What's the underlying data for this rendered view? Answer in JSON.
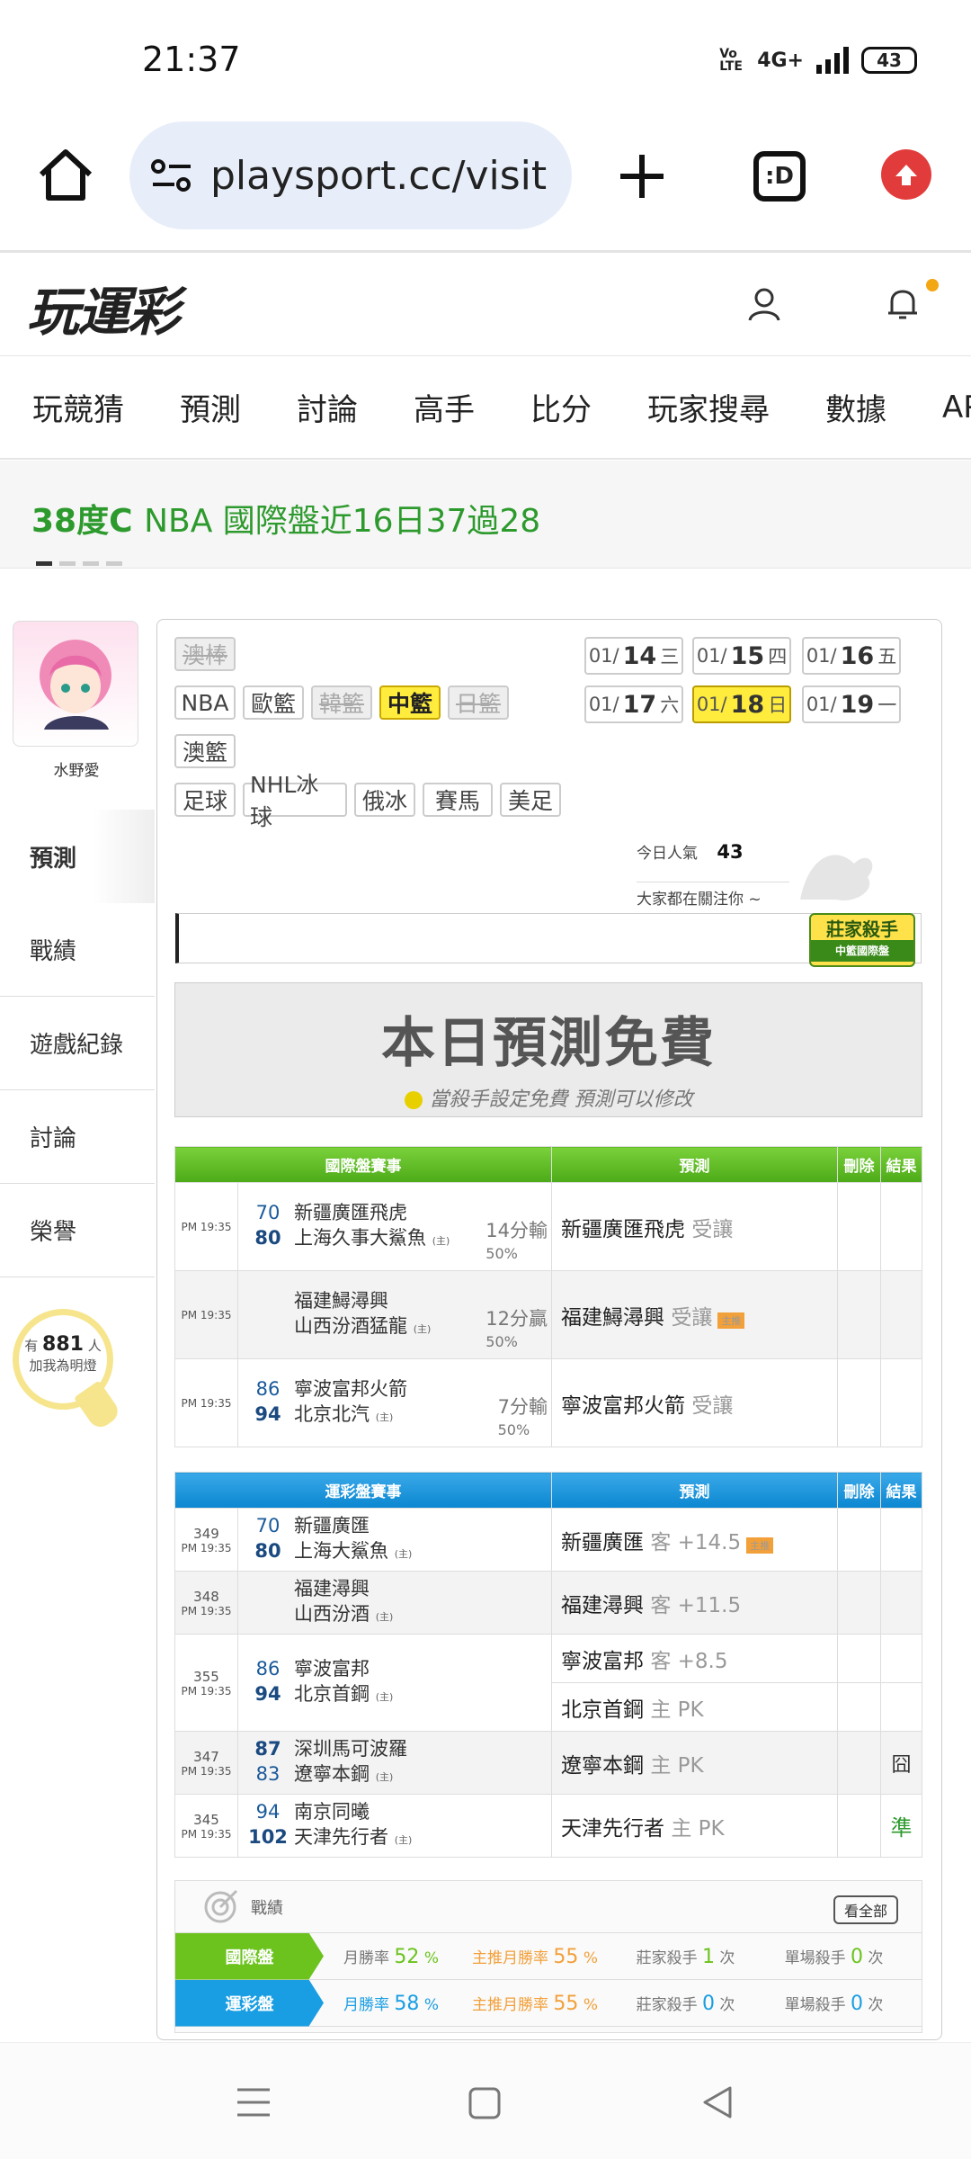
{
  "status": {
    "time": "21:37",
    "volte": "Vo LTE",
    "network": "4G+",
    "battery": "43"
  },
  "browser": {
    "url": "playsport.cc/visit",
    "tab_label": ":D"
  },
  "site": {
    "logo": "玩運彩"
  },
  "nav": [
    "玩競猜",
    "預測",
    "討論",
    "高手",
    "比分",
    "玩家搜尋",
    "數據",
    "APP"
  ],
  "marquee": {
    "highlight": "38度C",
    "text": "NBA 國際盤近16日37過28"
  },
  "profile": {
    "name": "水野愛",
    "fans_prefix": "有",
    "fans_count": "881",
    "fans_suffix": "人",
    "fans_label": "加我為明燈"
  },
  "side_menu": [
    "預測",
    "戰績",
    "遊戲紀錄",
    "討論",
    "榮譽"
  ],
  "sports": {
    "row1": [
      "澳棒"
    ],
    "row2": [
      "NBA",
      "歐籃",
      "韓籃",
      "中籃",
      "日籃"
    ],
    "row3": [
      "澳籃"
    ],
    "row4": [
      "足球",
      "NHL冰球",
      "俄冰",
      "賽馬",
      "美足"
    ]
  },
  "dates": [
    {
      "md": "01/",
      "d": "14",
      "w": "三"
    },
    {
      "md": "01/",
      "d": "15",
      "w": "四"
    },
    {
      "md": "01/",
      "d": "16",
      "w": "五"
    },
    {
      "md": "01/",
      "d": "17",
      "w": "六"
    },
    {
      "md": "01/",
      "d": "18",
      "w": "日"
    },
    {
      "md": "01/",
      "d": "19",
      "w": "一"
    }
  ],
  "popularity": {
    "label": "今日人氣",
    "value": "43",
    "watching": "大家都在關注你 ~"
  },
  "ribbon": {
    "title": "莊家殺手",
    "sub": "中籃國際盤"
  },
  "banner": {
    "title": "本日預測免費",
    "subtitle": "當殺手設定免費  預測可以修改"
  },
  "intl": {
    "headers": [
      "國際盤賽事",
      "預測",
      "刪除",
      "結果"
    ],
    "rows": [
      {
        "time": "PM 19:35",
        "s1": "70",
        "s2": "80",
        "t1": "新疆廣匯飛虎",
        "t2": "上海久事大鯊魚",
        "home": "(主)",
        "res1": "14分輸",
        "res2": "50%",
        "pred": "新疆廣匯飛虎",
        "note": "受讓",
        "mark": ""
      },
      {
        "time": "PM 19:35",
        "s1": "",
        "s2": "",
        "t1": "福建鱘潯興",
        "t2": "山西汾酒猛龍",
        "home": "(主)",
        "res1": "12分贏",
        "res2": "50%",
        "pred": "福建鱘潯興",
        "note": "受讓",
        "mark": "主推"
      },
      {
        "time": "PM 19:35",
        "s1": "86",
        "s2": "94",
        "t1": "寧波富邦火箭",
        "t2": "北京北汽",
        "home": "(主)",
        "res1": "7分輸",
        "res2": "50%",
        "pred": "寧波富邦火箭",
        "note": "受讓",
        "mark": ""
      }
    ]
  },
  "local": {
    "headers": [
      "運彩盤賽事",
      "預測",
      "刪除",
      "結果"
    ],
    "rows": [
      {
        "no": "349",
        "time": "PM 19:35",
        "s1": "70",
        "s2": "80",
        "t1": "新疆廣匯",
        "t2": "上海大鯊魚",
        "home": "(主)",
        "pred": "新疆廣匯",
        "note": "客 +14.5",
        "mark": "主推",
        "result": ""
      },
      {
        "no": "348",
        "time": "PM 19:35",
        "s1": "",
        "s2": "",
        "t1": "福建潯興",
        "t2": "山西汾酒",
        "home": "(主)",
        "pred": "福建潯興",
        "note": "客 +11.5",
        "mark": "",
        "result": ""
      },
      {
        "no": "355",
        "time": "PM 19:35",
        "s1": "86",
        "s2": "94",
        "t1": "寧波富邦",
        "t2": "北京首鋼",
        "home": "(主)",
        "pred": "寧波富邦",
        "note": "客 +8.5",
        "pred2": "北京首鋼",
        "note2": "主 PK",
        "mark": "",
        "result": ""
      },
      {
        "no": "347",
        "time": "PM 19:35",
        "s1": "87",
        "s2": "83",
        "t1": "深圳馬可波羅",
        "t2": "遼寧本鋼",
        "home": "(主)",
        "pred": "遼寧本鋼",
        "note": "主 PK",
        "mark": "",
        "result": "囧"
      },
      {
        "no": "345",
        "time": "PM 19:35",
        "s1": "94",
        "s2": "102",
        "t1": "南京同曦",
        "t2": "天津先行者",
        "home": "(主)",
        "pred": "天津先行者",
        "note": "主 PK",
        "mark": "",
        "result": "準"
      }
    ]
  },
  "record": {
    "title": "戰績",
    "view_all": "看全部",
    "rows": [
      {
        "label": "國際盤",
        "c1": "月勝率",
        "v1": "52",
        "u1": "%",
        "c2": "主推月勝率",
        "v2": "55",
        "u2": "%",
        "c3": "莊家殺手",
        "v3": "1",
        "u3": "次",
        "c4": "單場殺手",
        "v4": "0",
        "u4": "次"
      },
      {
        "label": "運彩盤",
        "c1": "月勝率",
        "v1": "58",
        "u1": "%",
        "c2": "主推月勝率",
        "v2": "55",
        "u2": "%",
        "c3": "莊家殺手",
        "v3": "0",
        "u3": "次",
        "c4": "單場殺手",
        "v4": "0",
        "u4": "次"
      }
    ]
  },
  "colors": {
    "green": "#4caa18",
    "blue": "#0a86d0",
    "accent_yellow": "#ffec3d",
    "marquee": "#2d9a2d"
  }
}
